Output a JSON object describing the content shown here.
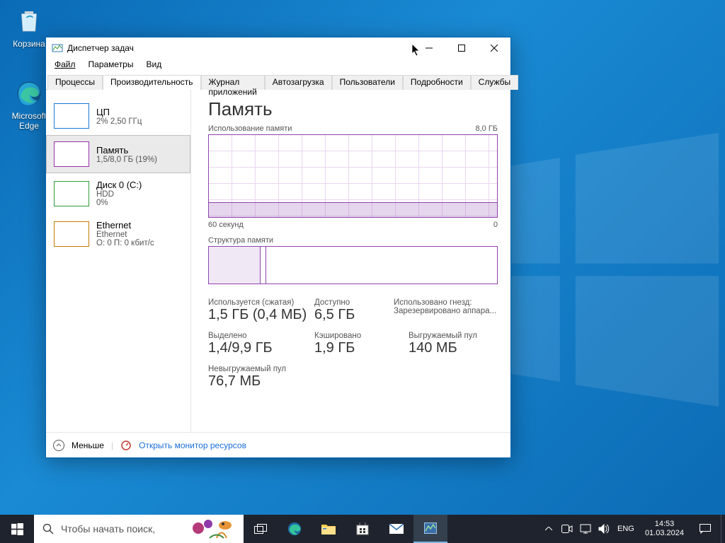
{
  "desktop": {
    "icons": [
      {
        "name": "Корзина",
        "kind": "recycle-bin"
      },
      {
        "name": "Microsoft Edge",
        "kind": "edge"
      }
    ]
  },
  "window": {
    "title": "Диспетчер задач",
    "menu": {
      "file": "Файл",
      "options": "Параметры",
      "view": "Вид"
    },
    "tabs": [
      "Процессы",
      "Производительность",
      "Журнал приложений",
      "Автозагрузка",
      "Пользователи",
      "Подробности",
      "Службы"
    ],
    "active_tab": 1,
    "sidebar": [
      {
        "title": "ЦП",
        "sub": "2% 2,50 ГГц",
        "color": "cpu"
      },
      {
        "title": "Память",
        "sub": "1,5/8,0 ГБ (19%)",
        "color": "mem",
        "selected": true
      },
      {
        "title": "Диск 0 (C:)",
        "sub1": "HDD",
        "sub2": "0%",
        "color": "disk"
      },
      {
        "title": "Ethernet",
        "sub1": "Ethernet",
        "sub2": "О: 0 П: 0 кбит/с",
        "color": "net"
      }
    ],
    "main": {
      "heading": "Память",
      "usage_label": "Использование памяти",
      "max_label": "8,0 ГБ",
      "x_left": "60 секунд",
      "x_right": "0",
      "struct_label": "Структура памяти",
      "stats": {
        "inuse_lbl": "Используется (сжатая)",
        "inuse_val": "1,5 ГБ (0,4 МБ)",
        "avail_lbl": "Доступно",
        "avail_val": "6,5 ГБ",
        "slots_lbl": "Использовано гнезд:",
        "slots_val": "Зарезервировано аппара...",
        "commit_lbl": "Выделено",
        "commit_val": "1,4/9,9 ГБ",
        "cached_lbl": "Кэшировано",
        "cached_val": "1,9 ГБ",
        "paged_lbl": "Выгружаемый пул",
        "paged_val": "140 МБ",
        "nonpaged_lbl": "Невыгружаемый пул",
        "nonpaged_val": "76,7 МБ"
      }
    },
    "bottom": {
      "fewer": "Меньше",
      "resmon": "Открыть монитор ресурсов"
    }
  },
  "taskbar": {
    "search_placeholder": "Чтобы начать поиск,",
    "lang": "ENG",
    "time": "14:53",
    "date": "01.03.2024"
  },
  "chart_data": {
    "type": "area",
    "title": "Использование памяти",
    "ylabel": "ГБ",
    "ylim": [
      0,
      8
    ],
    "x": [
      "60 секунд",
      "0"
    ],
    "series": [
      {
        "name": "Память",
        "values_approx_gb": 1.5,
        "percent": 19
      }
    ]
  }
}
